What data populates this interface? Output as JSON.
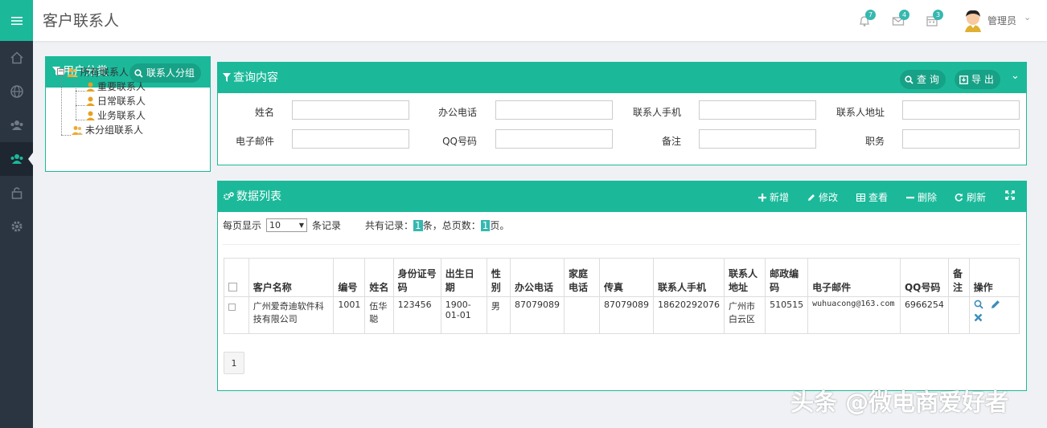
{
  "header": {
    "title": "客户联系人",
    "notifications": {
      "bell_count": "7",
      "mail_count": "4",
      "calendar_count": "3"
    },
    "user_name": "管理员"
  },
  "nav": {
    "items": [
      "home-icon",
      "globe-icon",
      "group-icon",
      "users-icon",
      "unlock-icon",
      "gear-icon"
    ]
  },
  "category_panel": {
    "title": "用户分类",
    "group_button": "联系人分组",
    "tree": {
      "root": "所有联系人",
      "children": [
        "重要联系人",
        "日常联系人",
        "业务联系人"
      ],
      "ungrouped": "未分组联系人"
    }
  },
  "query_panel": {
    "title": "查询内容",
    "search_button": "查 询",
    "export_button": "导 出",
    "fields": {
      "name": "姓名",
      "office_phone": "办公电话",
      "mobile": "联系人手机",
      "address": "联系人地址",
      "email": "电子邮件",
      "qq": "QQ号码",
      "remark": "备注",
      "title": "职务"
    }
  },
  "list_panel": {
    "title": "数据列表",
    "toolbar": {
      "add": "新增",
      "edit": "修改",
      "view": "查看",
      "delete": "删除",
      "refresh": "刷新"
    },
    "page_size_label": "每页显示",
    "page_size": "10",
    "records_suffix": "条记录",
    "total_label": "共有记录：",
    "total_records": "1",
    "total_mid": "条，总页数：",
    "total_pages": "1",
    "total_suffix": "页。",
    "columns": [
      "客户名称",
      "编号",
      "姓名",
      "身份证号码",
      "出生日期",
      "性别",
      "办公电话",
      "家庭电话",
      "传真",
      "联系人手机",
      "联系人地址",
      "邮政编码",
      "电子邮件",
      "QQ号码",
      "备注",
      "操作"
    ],
    "rows": [
      {
        "customer": "广州爱奇迪软件科技有限公司",
        "id": "1001",
        "name": "伍华聪",
        "idcard": "123456",
        "birth": "1900-01-01",
        "gender": "男",
        "office_phone": "87079089",
        "home_phone": "",
        "fax": "87079089",
        "mobile": "18620292076",
        "address": "广州市白云区",
        "zip": "510515",
        "email": "wuhuacong@163.com",
        "qq": "6966254",
        "remark": ""
      }
    ],
    "current_page": "1"
  },
  "watermark": "头条 @微电商爱好者",
  "colors": {
    "accent": "#1bb99a",
    "nav_bg": "#2b3542",
    "badge": "#36b8b0",
    "action_icon": "#3c8dbc"
  }
}
